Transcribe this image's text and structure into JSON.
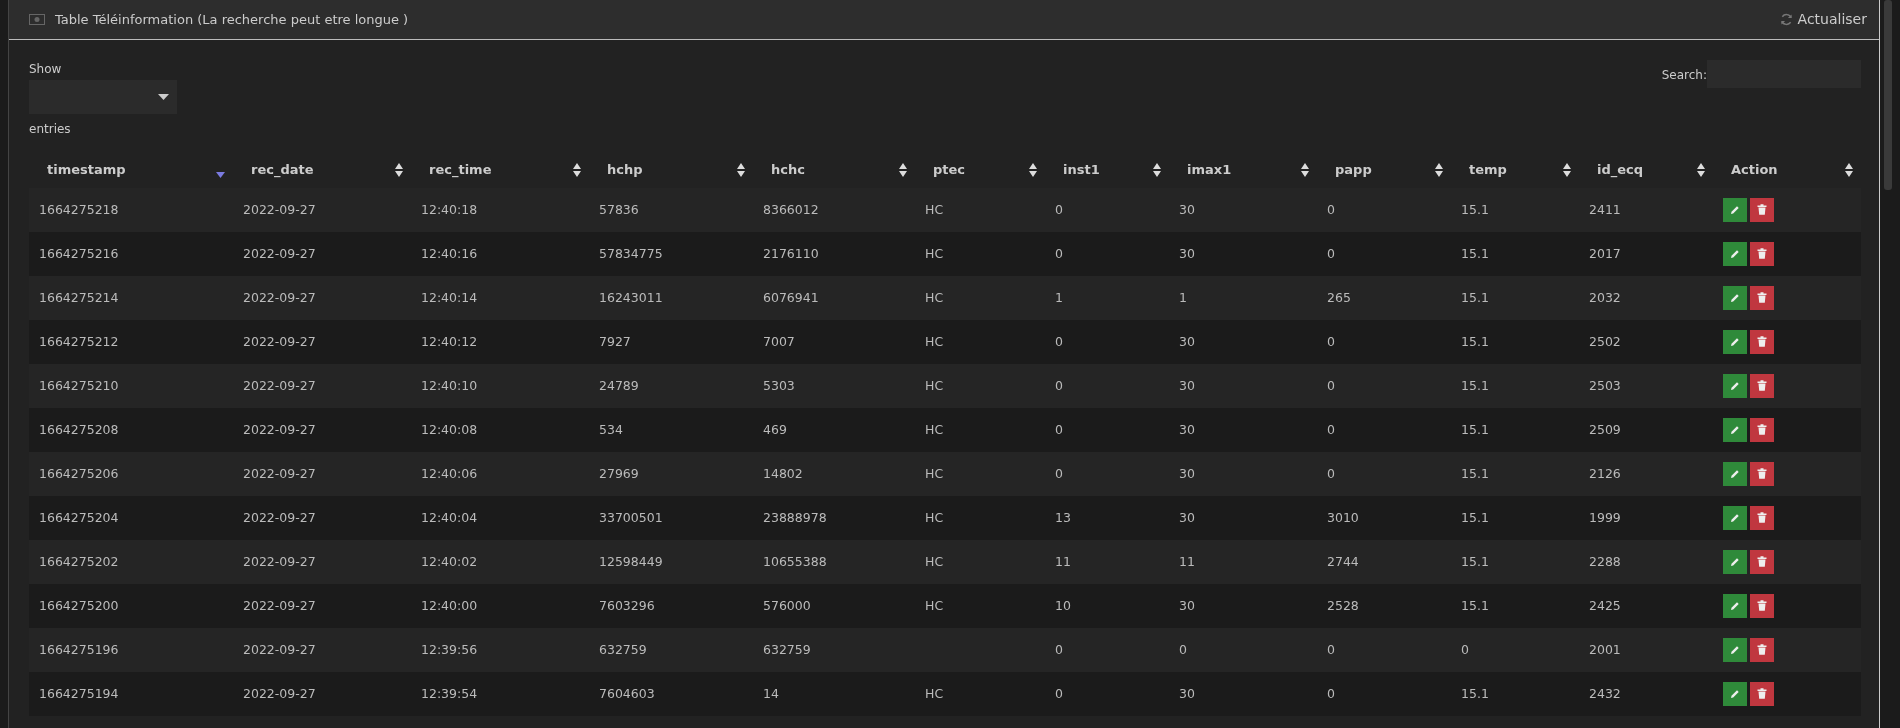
{
  "panel": {
    "title": "Table Téléinformation (La recherche peut etre longue )",
    "refresh_label": "Actualiser"
  },
  "length_control": {
    "label_before": "Show",
    "label_after": "entries"
  },
  "search": {
    "label": "Search:"
  },
  "table": {
    "columns": [
      {
        "label": "timestamp",
        "sorted": true
      },
      {
        "label": "rec_date",
        "sorted": false
      },
      {
        "label": "rec_time",
        "sorted": false
      },
      {
        "label": "hchp",
        "sorted": false
      },
      {
        "label": "hchc",
        "sorted": false
      },
      {
        "label": "ptec",
        "sorted": false
      },
      {
        "label": "inst1",
        "sorted": false
      },
      {
        "label": "imax1",
        "sorted": false
      },
      {
        "label": "papp",
        "sorted": false
      },
      {
        "label": "temp",
        "sorted": false
      },
      {
        "label": "id_ecq",
        "sorted": false
      },
      {
        "label": "Action",
        "sorted": false
      }
    ],
    "rows": [
      {
        "cells": [
          "1664275218",
          "2022-09-27",
          "12:40:18",
          "57836",
          "8366012",
          "HC",
          "0",
          "30",
          "0",
          "15.1",
          "2411"
        ]
      },
      {
        "cells": [
          "1664275216",
          "2022-09-27",
          "12:40:16",
          "57834775",
          "2176110",
          "HC",
          "0",
          "30",
          "0",
          "15.1",
          "2017"
        ]
      },
      {
        "cells": [
          "1664275214",
          "2022-09-27",
          "12:40:14",
          "16243011",
          "6076941",
          "HC",
          "1",
          "1",
          "265",
          "15.1",
          "2032"
        ]
      },
      {
        "cells": [
          "1664275212",
          "2022-09-27",
          "12:40:12",
          "7927",
          "7007",
          "HC",
          "0",
          "30",
          "0",
          "15.1",
          "2502"
        ]
      },
      {
        "cells": [
          "1664275210",
          "2022-09-27",
          "12:40:10",
          "24789",
          "5303",
          "HC",
          "0",
          "30",
          "0",
          "15.1",
          "2503"
        ]
      },
      {
        "cells": [
          "1664275208",
          "2022-09-27",
          "12:40:08",
          "534",
          "469",
          "HC",
          "0",
          "30",
          "0",
          "15.1",
          "2509"
        ]
      },
      {
        "cells": [
          "1664275206",
          "2022-09-27",
          "12:40:06",
          "27969",
          "14802",
          "HC",
          "0",
          "30",
          "0",
          "15.1",
          "2126"
        ]
      },
      {
        "cells": [
          "1664275204",
          "2022-09-27",
          "12:40:04",
          "33700501",
          "23888978",
          "HC",
          "13",
          "30",
          "3010",
          "15.1",
          "1999"
        ]
      },
      {
        "cells": [
          "1664275202",
          "2022-09-27",
          "12:40:02",
          "12598449",
          "10655388",
          "HC",
          "11",
          "11",
          "2744",
          "15.1",
          "2288"
        ]
      },
      {
        "cells": [
          "1664275200",
          "2022-09-27",
          "12:40:00",
          "7603296",
          "576000",
          "HC",
          "10",
          "30",
          "2528",
          "15.1",
          "2425"
        ]
      },
      {
        "cells": [
          "1664275196",
          "2022-09-27",
          "12:39:56",
          "632759",
          "632759",
          null,
          "0",
          "0",
          "0",
          "0",
          "2001"
        ]
      },
      {
        "cells": [
          "1664275194",
          "2022-09-27",
          "12:39:54",
          "7604603",
          "14",
          "HC",
          "0",
          "30",
          "0",
          "15.1",
          "2432"
        ]
      }
    ]
  }
}
